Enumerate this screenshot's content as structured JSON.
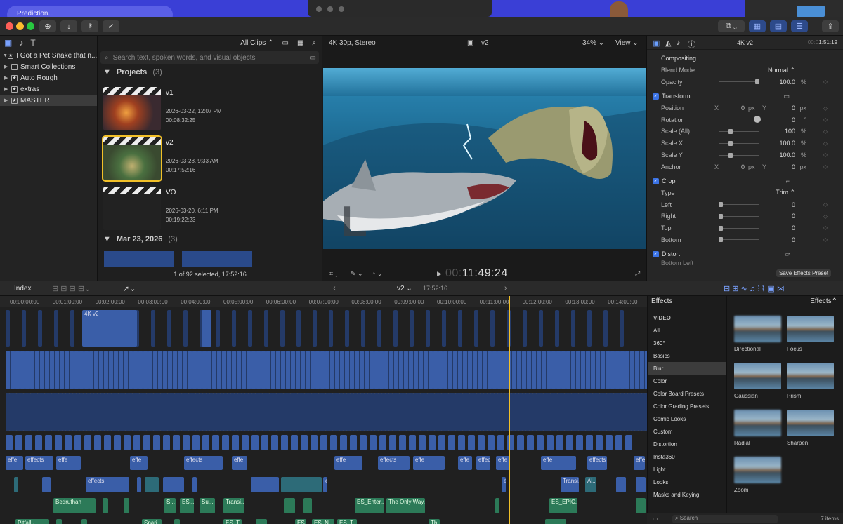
{
  "desktop": {
    "pill_text": "Prediction..."
  },
  "toolbar": {
    "buttons": [
      "import-icon",
      "download-icon",
      "key-icon",
      "check-icon"
    ]
  },
  "library": {
    "items": [
      {
        "label": "I Got a Pet Snake that n..."
      },
      {
        "label": "Smart Collections"
      },
      {
        "label": "Auto Rough"
      },
      {
        "label": "extras"
      },
      {
        "label": "MASTER"
      }
    ]
  },
  "browser": {
    "filter": "All Clips",
    "search_placeholder": "Search text, spoken words, and visual objects",
    "section1": {
      "title": "Projects",
      "count": "(3)"
    },
    "projects": [
      {
        "name": "v1",
        "date": "2026-03-22, 12:07 PM",
        "duration": "00:08:32:25"
      },
      {
        "name": "v2",
        "date": "2026-03-28, 9:33 AM",
        "duration": "00:17:52:16"
      },
      {
        "name": "VO",
        "date": "2026-03-20, 6:11 PM",
        "duration": "00:19:22:23"
      }
    ],
    "section2": {
      "title": "Mar 23, 2026",
      "count": "(3)"
    },
    "status": "1 of 92 selected, 17:52:16"
  },
  "viewer": {
    "format": "4K 30p, Stereo",
    "project": "v2",
    "zoom": "34%",
    "view": "View",
    "timecode_dim": "00:",
    "timecode": "11:49:24"
  },
  "inspector": {
    "title": "4K v2",
    "time_dim": "00:0",
    "time": "1:51:19",
    "compositing": "Compositing",
    "blend_mode_label": "Blend Mode",
    "blend_mode": "Normal",
    "opacity_label": "Opacity",
    "opacity": "100.0",
    "transform": "Transform",
    "position": {
      "label": "Position",
      "x": "0",
      "y": "0",
      "unit": "px"
    },
    "rotation": {
      "label": "Rotation",
      "value": "0",
      "unit": "°"
    },
    "scale_all": {
      "label": "Scale (All)",
      "value": "100"
    },
    "scale_x": {
      "label": "Scale X",
      "value": "100.0"
    },
    "scale_y": {
      "label": "Scale Y",
      "value": "100.0"
    },
    "anchor": {
      "label": "Anchor",
      "x": "0",
      "y": "0",
      "unit": "px"
    },
    "crop": "Crop",
    "type_label": "Type",
    "type": "Trim",
    "left": {
      "label": "Left",
      "value": "0"
    },
    "right": {
      "label": "Right",
      "value": "0"
    },
    "top": {
      "label": "Top",
      "value": "0"
    },
    "bottom": {
      "label": "Bottom",
      "value": "0"
    },
    "distort": "Distort",
    "distort_next": "Bottom Left",
    "save_preset": "Save Effects Preset",
    "x_label": "X",
    "y_label": "Y",
    "pct": "%"
  },
  "timeline": {
    "index": "Index",
    "project": "v2",
    "duration": "17:52:16",
    "ruler": [
      "00:00:00:00",
      "00:01:00:00",
      "00:02:00:00",
      "00:03:00:00",
      "00:04:00:00",
      "00:05:00:00",
      "00:06:00:00",
      "00:07:00:00",
      "00:08:00:00",
      "00:09:00:00",
      "00:10:00:00",
      "00:11:00:00",
      "00:12:00:00",
      "00:13:00:00",
      "00:14:00:00"
    ],
    "clip_labels": {
      "v2": "4K v2",
      "effects": "effects",
      "effe": "effe",
      "e": "e",
      "transi": "Transi...",
      "bedruthan": "Bedruthan",
      "es_enter": "ES_Enter...",
      "only_way": "The Only Way...",
      "es_epic": "ES_EPIC...",
      "pitfall": "Pitfall -...",
      "spari": "Spari...",
      "es_n": "ES_N...",
      "es_t": "ES_T...",
      "es": "ES...",
      "su": "Su...",
      "s": "S...",
      "al": "Al...",
      "th": "Th..."
    }
  },
  "effects": {
    "header": "Effects",
    "dropdown": "Effects",
    "categories": [
      "VIDEO",
      "All",
      "360°",
      "Basics",
      "Blur",
      "Color",
      "Color Board Presets",
      "Color Grading Presets",
      "Comic Looks",
      "Custom",
      "Distortion",
      "Insta360",
      "Light",
      "Looks",
      "Masks and Keying"
    ],
    "selected_category": "Blur",
    "items": [
      "Directional",
      "Focus",
      "Gaussian",
      "Prism",
      "Radial",
      "Sharpen",
      "Zoom"
    ],
    "search_placeholder": "Search",
    "count": "7 items"
  }
}
